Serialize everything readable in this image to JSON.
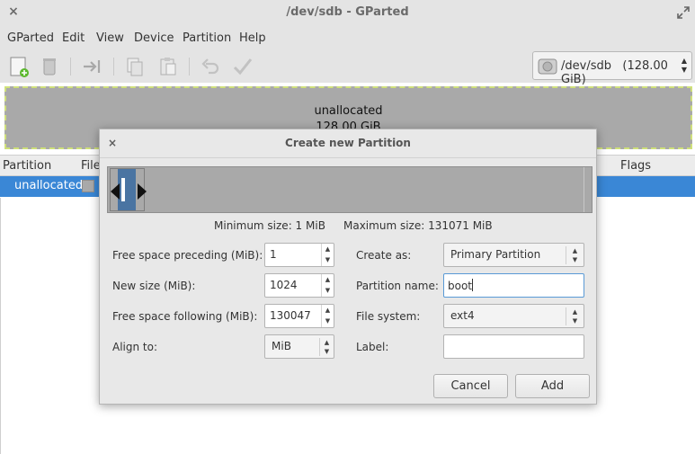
{
  "window": {
    "title": "/dev/sdb - GParted",
    "close_glyph": "×"
  },
  "menu": [
    "GParted",
    "Edit",
    "View",
    "Device",
    "Partition",
    "Help"
  ],
  "toolbar": {
    "icons": [
      "new-partition-icon",
      "delete-icon",
      "resize-move-icon",
      "copy-icon",
      "paste-icon",
      "undo-icon",
      "apply-icon"
    ]
  },
  "device_selector": {
    "device": "/dev/sdb",
    "size": "(128.00 GiB)"
  },
  "disk_map": {
    "label": "unallocated",
    "size": "128.00 GiB"
  },
  "partition_table": {
    "columns": [
      "Partition",
      "File",
      "Flags"
    ],
    "rows": [
      {
        "partition": "unallocated"
      }
    ]
  },
  "dialog": {
    "title": "Create new Partition",
    "close_glyph": "×",
    "min_size": "Minimum size: 1 MiB",
    "max_size": "Maximum size: 131071 MiB",
    "fields": {
      "free_preceding": {
        "label": "Free space preceding (MiB):",
        "value": "1"
      },
      "new_size": {
        "label": "New size (MiB):",
        "value": "1024"
      },
      "free_following": {
        "label": "Free space following (MiB):",
        "value": "130047"
      },
      "align_to": {
        "label": "Align to:",
        "value": "MiB"
      },
      "create_as": {
        "label": "Create as:",
        "value": "Primary Partition"
      },
      "partition_name": {
        "label": "Partition name:",
        "value": "boot"
      },
      "file_system": {
        "label": "File system:",
        "value": "ext4"
      },
      "label": {
        "label": "Label:",
        "value": ""
      }
    },
    "buttons": {
      "cancel": "Cancel",
      "add": "Add"
    }
  },
  "colors": {
    "selection": "#3a87d6",
    "unallocated": "#a9a9a9",
    "partition_fill": "#4a74a2",
    "focus": "#5a9ad6"
  }
}
